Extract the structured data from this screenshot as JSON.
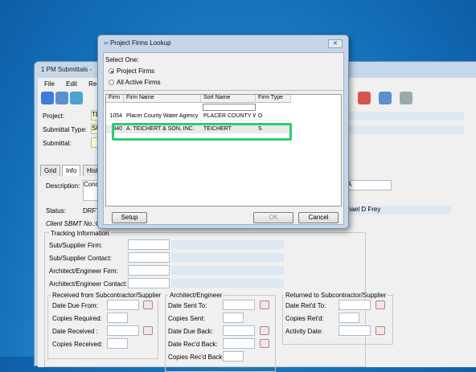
{
  "main_window": {
    "title": "1 PM Submittals -",
    "menu": [
      "File",
      "Edit",
      "Reco"
    ],
    "project_label": "Project:",
    "project_value": "TE",
    "submittal_type_label": "Submittal Type:",
    "submittal_type_value": "SU",
    "submittal_label": "Submittal:",
    "tabs": [
      "Grid",
      "Info",
      "Histo"
    ],
    "description_label": "Description:",
    "description_value": "Concr",
    "right_field_value": "A",
    "status_label": "Status:",
    "status_value": "DRFT",
    "person_value": "hael D Frey",
    "client_label": "Client SBMT No.:",
    "client_value": "C",
    "tracking": {
      "title": "Tracking Information",
      "labels": [
        "Sub/Supplier Firm:",
        "Sub/Supplier Contact:",
        "Architect/Engineer Firm:",
        "Architect/Engineer Contact:"
      ]
    },
    "received_group": {
      "title": "Received from Subcontractor/Supplier",
      "labels": [
        "Date Due From:",
        "Copies Required:",
        "Date Received :",
        "Copies Received:"
      ]
    },
    "arch_group": {
      "title": "Architect/Engineer",
      "labels": [
        "Date Sent To:",
        "Copies Sent:",
        "Date Due Back:",
        "Date Rec'd Back:",
        "Copies Rec'd Back:"
      ]
    },
    "returned_group": {
      "title": "Returned to Subcontractor/Supplier",
      "labels": [
        "Date Ret'd To:",
        "Copies Ret'd:",
        "Activity Date:"
      ]
    }
  },
  "dialog": {
    "title": "Project Firms Lookup",
    "close": "✕",
    "select_label": "Select One:",
    "options": [
      "Project Firms",
      "All Active Firms"
    ],
    "columns": [
      "Firm",
      "Firm Name",
      "Sort Name",
      "Firm Type"
    ],
    "rows": [
      {
        "firm": "1054",
        "name": "Placer County Water Agency",
        "sort": "PLACER COUNTY W",
        "type": "O"
      },
      {
        "firm": "340",
        "name": "A. TEICHERT & SON, INC.",
        "sort": "TEICHERT",
        "type": "S"
      }
    ],
    "buttons": {
      "setup": "Setup",
      "ok": "OK",
      "cancel": "Cancel"
    }
  },
  "colors": {
    "highlight": "#2ecc71",
    "title_bar": "#c5d6e8"
  }
}
